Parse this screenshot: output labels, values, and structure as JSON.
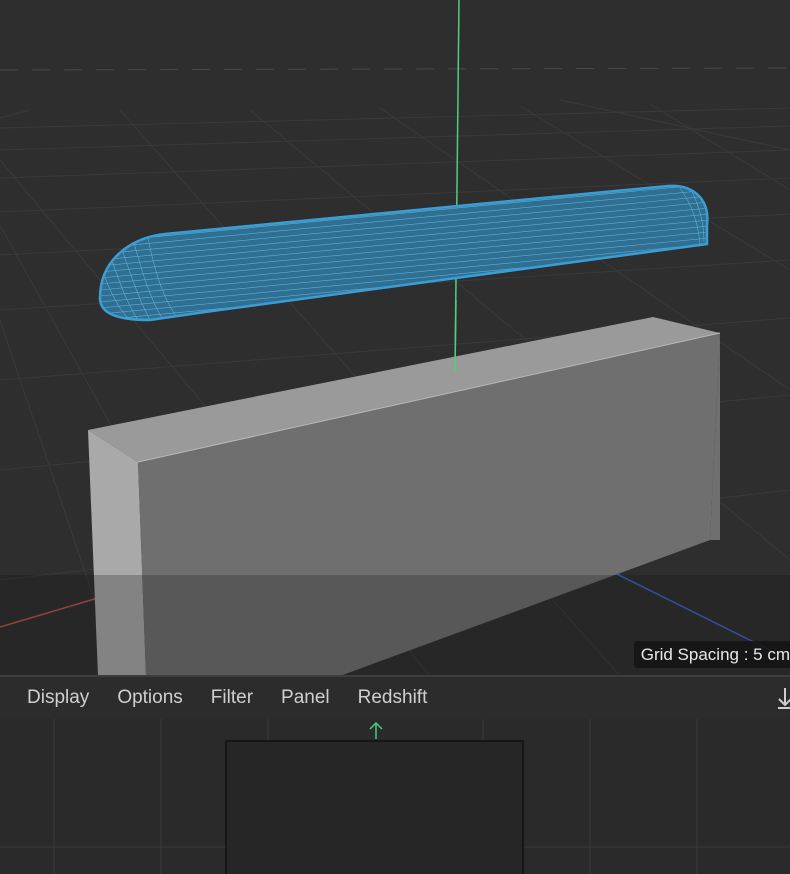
{
  "viewport": {
    "grid_spacing_label": "Grid Spacing : 5 cm",
    "colors": {
      "background": "#2e2e2e",
      "y_axis": "#4cd07a",
      "x_axis": "#c0504a",
      "z_axis": "#3a63c8",
      "wireframe": "#3b9dd4",
      "cube_front": "#6f6f6f",
      "cube_top": "#9a9a9a",
      "cube_side": "#a9a9a9"
    },
    "objects": [
      {
        "name": "capsule-wireframe",
        "shading": "wireframe"
      },
      {
        "name": "cube",
        "shading": "gouraud"
      }
    ]
  },
  "menubar": {
    "items": [
      {
        "label": "Display"
      },
      {
        "label": "Options"
      },
      {
        "label": "Filter"
      },
      {
        "label": "Panel"
      },
      {
        "label": "Redshift"
      }
    ],
    "right_icon": "arrow-down-icon"
  },
  "bottom_view": {
    "icon": "y-axis-up-arrow-icon"
  }
}
